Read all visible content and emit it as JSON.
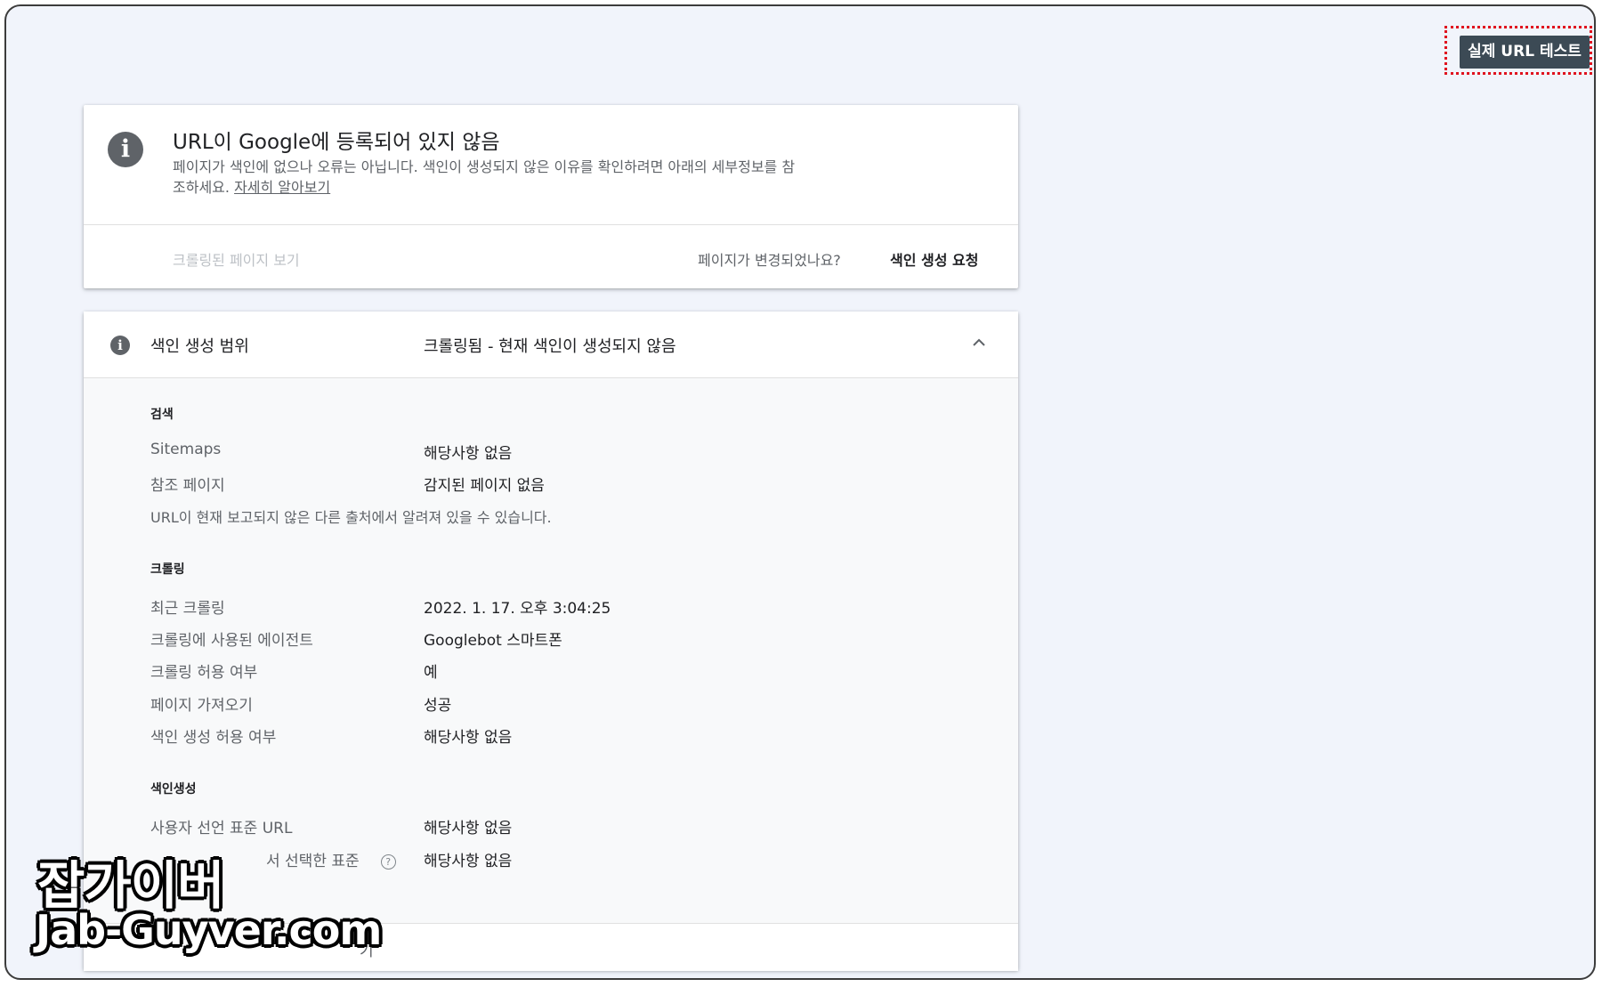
{
  "toolbar": {
    "live_test_label": "실제 URL 테스트"
  },
  "status_card": {
    "icon": "info-icon",
    "title": "URL이 Google에 등록되어 있지 않음",
    "description": "페이지가 색인에 없으나 오류는 아닙니다. 색인이 생성되지 않은 이유를 확인하려면 아래의 세부정보를 참조하세요.",
    "learn_more": "자세히 알아보기",
    "crawled_page_link": "크롤링된 페이지 보기",
    "page_changed": "페이지가 변경되었나요?",
    "request_indexing": "색인 생성 요청"
  },
  "coverage_card": {
    "label": "색인 생성 범위",
    "value": "크롤링됨 - 현재 색인이 생성되지 않음",
    "sections": {
      "discovery": {
        "title": "검색",
        "rows": [
          {
            "label": "Sitemaps",
            "value": "해당사항 없음"
          },
          {
            "label": "참조 페이지",
            "value": "감지된 페이지 없음"
          }
        ],
        "note": "URL이 현재 보고되지 않은 다른 출처에서 알려져 있을 수 있습니다."
      },
      "crawl": {
        "title": "크롤링",
        "rows": [
          {
            "label": "최근 크롤링",
            "value": "2022. 1. 17. 오후 3:04:25"
          },
          {
            "label": "크롤링에 사용된 에이전트",
            "value": "Googlebot 스마트폰"
          },
          {
            "label": "크롤링 허용 여부",
            "value": "예"
          },
          {
            "label": "페이지 가져오기",
            "value": "성공"
          },
          {
            "label": "색인 생성 허용 여부",
            "value": "해당사항 없음"
          }
        ]
      },
      "indexing": {
        "title": "색인생성",
        "rows": [
          {
            "label": "사용자 선언 표준 URL",
            "value": "해당사항 없음"
          },
          {
            "label": "서 선택한 표준",
            "value": "해당사항 없음"
          }
        ]
      }
    },
    "footer_link": "기"
  },
  "watermark": {
    "title": "잡가이버",
    "url": "Jab-Guyver.com"
  }
}
